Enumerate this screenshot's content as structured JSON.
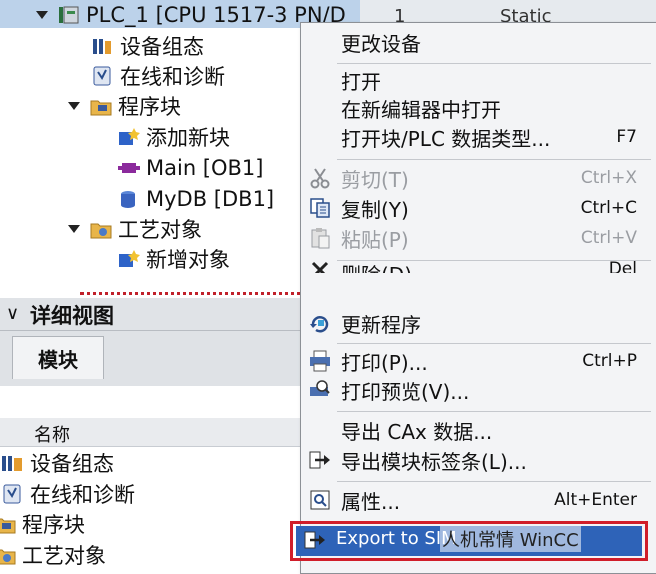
{
  "tree": {
    "header": "PLC_1 [CPU 1517-3 PN/D",
    "items": [
      {
        "label": "设备组态",
        "icon": "device-config-icon"
      },
      {
        "label": "在线和诊断",
        "icon": "online-diagnostics-icon"
      },
      {
        "label": "程序块",
        "icon": "program-blocks-folder-icon"
      },
      {
        "label": "添加新块",
        "icon": "add-block-icon"
      },
      {
        "label": "Main [OB1]",
        "icon": "ob-block-icon"
      },
      {
        "label": "MyDB [DB1]",
        "icon": "db-block-icon"
      },
      {
        "label": "工艺对象",
        "icon": "technology-objects-folder-icon"
      },
      {
        "label": "新增对象",
        "icon": "add-object-icon"
      }
    ]
  },
  "right_strip": {
    "row_number": "1",
    "static_label": "Static"
  },
  "detail": {
    "title": "详细视图",
    "tab": "模块",
    "column_header": "名称",
    "rows": [
      {
        "label": "设备组态",
        "icon": "device-config-icon"
      },
      {
        "label": "在线和诊断",
        "icon": "online-diagnostics-icon"
      },
      {
        "label": "程序块",
        "icon": "program-blocks-folder-icon"
      },
      {
        "label": "工艺对象",
        "icon": "technology-objects-folder-icon"
      }
    ]
  },
  "menu": {
    "change_device": "更改设备",
    "open": "打开",
    "open_new_editor": "在新编辑器中打开",
    "open_block": "打开块/PLC 数据类型...",
    "open_block_shortcut": "F7",
    "cut": "剪切(T)",
    "cut_shortcut": "Ctrl+X",
    "copy": "复制(Y)",
    "copy_shortcut": "Ctrl+C",
    "paste": "粘贴(P)",
    "paste_shortcut": "Ctrl+V",
    "delete": "删除(D)",
    "delete_shortcut": "Del",
    "update_program": "更新程序",
    "print": "打印(P)...",
    "print_shortcut": "Ctrl+P",
    "print_preview": "打印预览(V)...",
    "export_cax": "导出 CAx 数据...",
    "export_labels": "导出模块标签条(L)...",
    "properties": "属性...",
    "properties_shortcut": "Alt+Enter",
    "export_wincc": "Export to SIM",
    "watermark": "人机常情 WinCC"
  },
  "colors": {
    "highlight": "#2e63b8",
    "annotation_box": "#d01e2a",
    "header": "#bcd2ea"
  }
}
